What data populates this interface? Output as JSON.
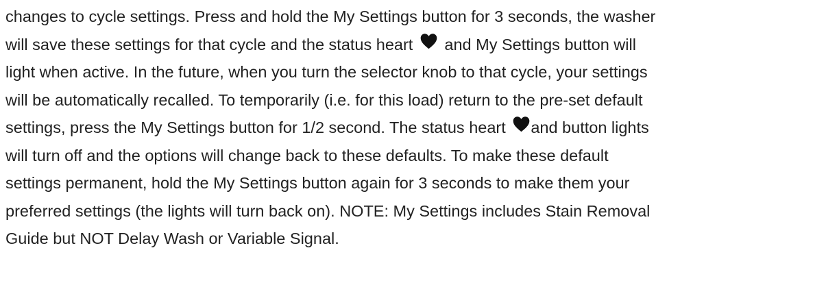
{
  "document": {
    "lines": {
      "l1": "changes to cycle settings. Press and hold the My Settings button for 3 seconds, the washer",
      "l2a": "will save these settings for that cycle and the status heart",
      "l2b": "and My Settings button will",
      "l3": "light when active. In the future, when you turn the selector knob to that cycle, your settings",
      "l4": "will be automatically recalled. To temporarily (i.e. for this load) return to the pre-set default",
      "l5a": "settings, press the My Settings button for 1/2 second. The status heart",
      "l5b": "and button lights",
      "l6": "will turn off and the options will change back to these defaults. To make these default",
      "l7": "settings permanent, hold the My Settings button again for 3 seconds to make them your",
      "l8": "preferred settings (the lights will turn back on). NOTE: My Settings includes Stain Removal",
      "l9": "Guide but NOT Delay Wash or Variable Signal."
    },
    "icons": {
      "status_heart": "heart-icon",
      "heart_color": "#111111"
    }
  }
}
